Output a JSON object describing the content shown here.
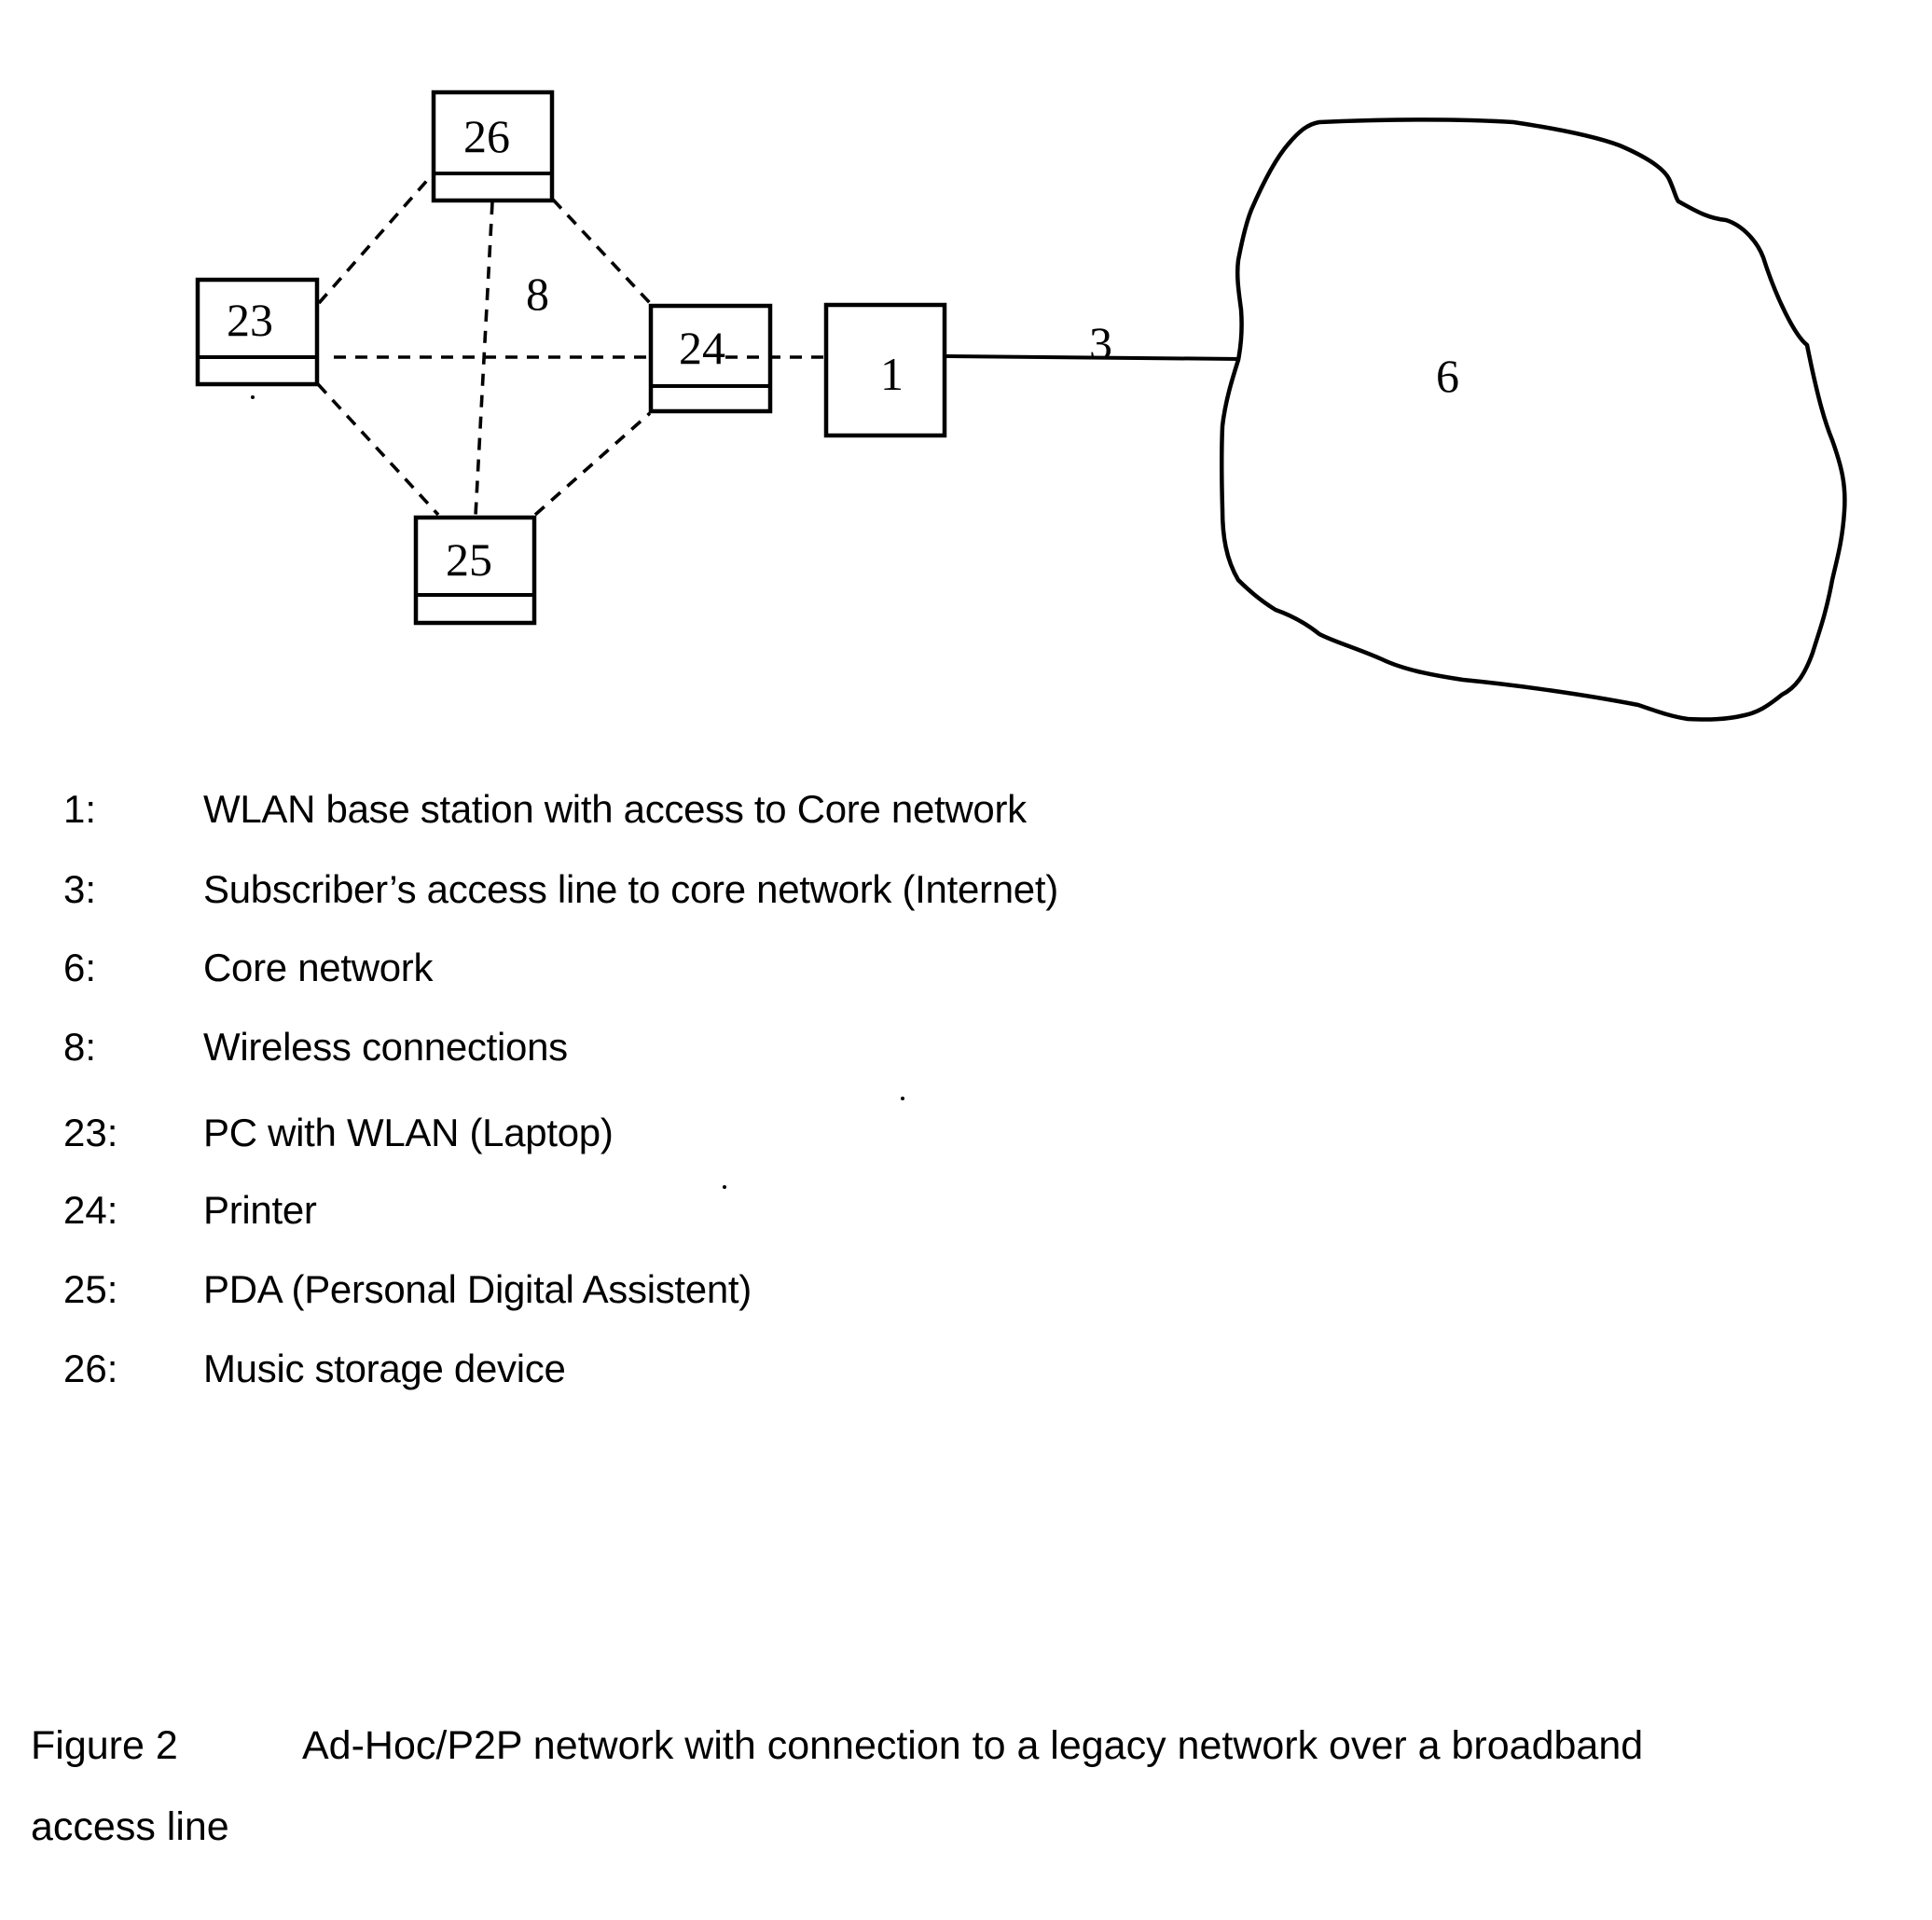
{
  "figure": {
    "label": "Figure 2",
    "caption_line1": "Ad-Hoc/P2P network with connection to a legacy network over a broadband",
    "caption_line2": "access line"
  },
  "diagram": {
    "nodes": [
      {
        "id": "26",
        "label": "26",
        "kind": "device"
      },
      {
        "id": "23",
        "label": "23",
        "kind": "device"
      },
      {
        "id": "24",
        "label": "24",
        "kind": "device"
      },
      {
        "id": "25",
        "label": "25",
        "kind": "device"
      },
      {
        "id": "1",
        "label": "1",
        "kind": "base-station"
      },
      {
        "id": "6",
        "label": "6",
        "kind": "cloud"
      }
    ],
    "edges": [
      {
        "from": "23",
        "to": "26",
        "style": "dashed"
      },
      {
        "from": "26",
        "to": "24",
        "style": "dashed"
      },
      {
        "from": "23",
        "to": "25",
        "style": "dashed"
      },
      {
        "from": "25",
        "to": "24",
        "style": "dashed"
      },
      {
        "from": "26",
        "to": "25",
        "style": "dashed"
      },
      {
        "from": "23",
        "to": "24",
        "style": "dashed"
      },
      {
        "from": "24",
        "to": "1",
        "style": "dashed"
      },
      {
        "from": "1",
        "to": "6",
        "style": "solid",
        "label": "3"
      }
    ],
    "wireless_label": "8",
    "access_line_label": "3"
  },
  "legend": [
    {
      "key": "1:",
      "text": "WLAN base station with access to Core network"
    },
    {
      "key": "3:",
      "text": "Subscriber’s access line to core network (Internet)"
    },
    {
      "key": "6:",
      "text": "Core network"
    },
    {
      "key": "8:",
      "text": "Wireless connections"
    },
    {
      "key": "23:",
      "text": "PC with WLAN (Laptop)"
    },
    {
      "key": "24:",
      "text": "Printer"
    },
    {
      "key": "25:",
      "text": "PDA (Personal Digital Assistent)"
    },
    {
      "key": "26:",
      "text": "Music storage device"
    }
  ]
}
